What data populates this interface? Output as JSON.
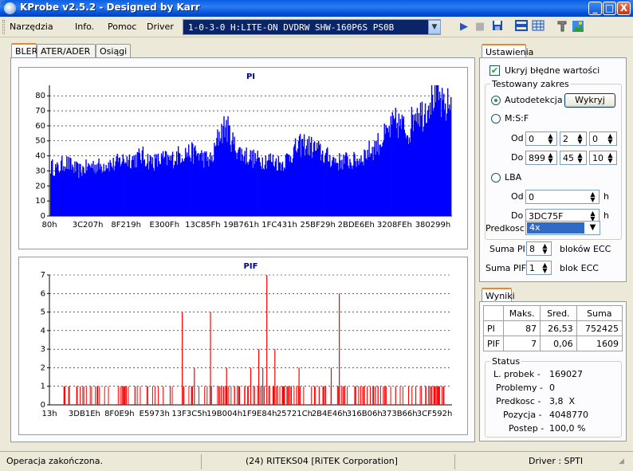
{
  "window": {
    "title": "KProbe v2.5.2 - Designed by Karr",
    "minimize": "_",
    "maximize": "□",
    "close": "X"
  },
  "menu": {
    "items": [
      "Narzędzia",
      "Info.",
      "Pomoc",
      "Driver"
    ]
  },
  "drive_selector": {
    "value": "1-0-3-0 H:LITE-ON DVDRW SHW-160P6S PS0B"
  },
  "toolbar": {
    "icons": [
      "play-icon",
      "stop-icon",
      "save-icon",
      "layout-icon",
      "grid-icon",
      "settings-icon",
      "picture-icon"
    ]
  },
  "tabs": {
    "bler": "BLER",
    "ater": "ATER/ADER",
    "osiagi": "Osiągi"
  },
  "settings": {
    "tab": "Ustawienia",
    "hide_errors_label": "Ukryj błędne wartości",
    "hide_errors_checked": true,
    "range_group": "Testowany zakres",
    "auto_label": "Autodetekcja",
    "detect_button": "Wykryj",
    "msf_label": "M:S:F",
    "od": "Od",
    "do": "Do",
    "msf_from": [
      "0",
      "2",
      "0"
    ],
    "msf_to": [
      "899",
      "45",
      "10"
    ],
    "lba_label": "LBA",
    "lba_from": "0",
    "lba_to": "3DC75F",
    "h": "h",
    "speed_label": "Predkosc",
    "speed_value": "4x",
    "sum_pi_label": "Suma PI",
    "sum_pi_value": "8",
    "sum_pi_unit": "bloków ECC",
    "sum_pif_label": "Suma PIF",
    "sum_pif_value": "1",
    "sum_pif_unit": "blok ECC"
  },
  "results": {
    "tab": "Wyniki",
    "headers": [
      "",
      "Maks.",
      "Sred.",
      "Suma"
    ],
    "rows": [
      [
        "PI",
        "87",
        "26,53",
        "752425"
      ],
      [
        "PIF",
        "7",
        "0,06",
        "1609"
      ]
    ],
    "status_group": "Status",
    "status": [
      {
        "label": "L. probek -",
        "value": "169027"
      },
      {
        "label": "Problemy -",
        "value": "0"
      },
      {
        "label": "Predkosc -",
        "value": "3,8  X"
      },
      {
        "label": "Pozycja -",
        "value": "4048770"
      },
      {
        "label": "Postep -",
        "value": "100,0 %"
      }
    ]
  },
  "statusbar": {
    "left": "Operacja zakończona.",
    "middle": "(24) RITEKS04 [RiTEK Corporation]",
    "right": "Driver : SPTI"
  },
  "colors": {
    "pi": "#0000ff",
    "pif": "#ff0000",
    "selection": "#316ac5",
    "titlebar": "#0a5fe5"
  },
  "chart_data": [
    {
      "type": "bar",
      "title": "PI",
      "yticks": [
        0,
        10,
        20,
        30,
        40,
        50,
        60,
        70,
        80
      ],
      "ylim": [
        0,
        87
      ],
      "xticks": [
        "80h",
        "3C207h",
        "8F219h",
        "E300Fh",
        "13C85Fh",
        "19B761h",
        "1FC431h",
        "25BF29h",
        "2BDE6Eh",
        "3208FEh",
        "380299h"
      ],
      "max": 87,
      "avg": 26.53,
      "profile": [
        33,
        31,
        36,
        33,
        30,
        32,
        34,
        33,
        35,
        34,
        37,
        38,
        38,
        40,
        37,
        36,
        38,
        37,
        40,
        42,
        42,
        41,
        38,
        37,
        55,
        60,
        48,
        42,
        40,
        38,
        37,
        38,
        36,
        35,
        40,
        45,
        48,
        46,
        44,
        40,
        38,
        36,
        37,
        36,
        38,
        42,
        45,
        50,
        55,
        62,
        60,
        56,
        72,
        68,
        78,
        82,
        70,
        76
      ]
    },
    {
      "type": "bar",
      "title": "PIF",
      "yticks": [
        0,
        1,
        2,
        3,
        4,
        5,
        6,
        7
      ],
      "ylim": [
        0,
        7
      ],
      "xticks": [
        "13h",
        "3DB1Eh",
        "8F0E9h",
        "E5973h",
        "13F3C5h",
        "19B004h",
        "1F9E84h",
        "25721Ch",
        "2B4E46h",
        "316B06h",
        "373B66h",
        "3CF592h"
      ],
      "max": 7,
      "avg": 0.06,
      "spikes": [
        [
          0.12,
          1
        ],
        [
          0.3,
          1
        ],
        [
          0.33,
          5
        ],
        [
          0.36,
          2
        ],
        [
          0.4,
          5
        ],
        [
          0.44,
          2
        ],
        [
          0.47,
          1
        ],
        [
          0.5,
          2
        ],
        [
          0.52,
          3
        ],
        [
          0.53,
          2
        ],
        [
          0.54,
          7
        ],
        [
          0.56,
          3
        ],
        [
          0.58,
          1
        ],
        [
          0.62,
          2
        ],
        [
          0.67,
          1
        ],
        [
          0.7,
          2
        ],
        [
          0.72,
          6
        ],
        [
          0.76,
          1
        ],
        [
          0.81,
          1
        ],
        [
          0.86,
          1
        ],
        [
          0.91,
          1
        ],
        [
          0.95,
          1
        ]
      ]
    }
  ]
}
